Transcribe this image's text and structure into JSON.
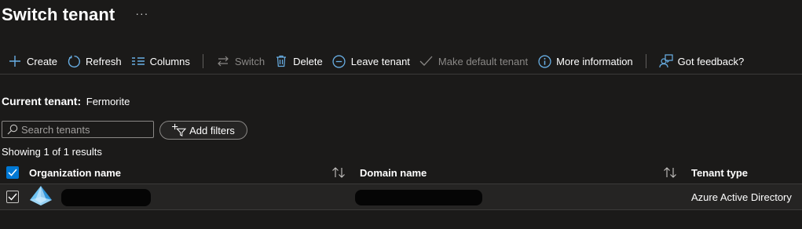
{
  "header": {
    "title": "Switch tenant",
    "more_label": "···"
  },
  "toolbar": {
    "create": "Create",
    "refresh": "Refresh",
    "columns": "Columns",
    "switch": "Switch",
    "delete": "Delete",
    "leave_tenant": "Leave tenant",
    "make_default": "Make default tenant",
    "more_info": "More information",
    "feedback": "Got feedback?"
  },
  "current_tenant": {
    "label": "Current tenant:",
    "value": "Fermorite"
  },
  "search": {
    "placeholder": "Search tenants",
    "value": ""
  },
  "filters": {
    "add_label": "Add filters"
  },
  "results": {
    "text": "Showing 1 of 1 results"
  },
  "table": {
    "columns": [
      "Organization name",
      "Domain name",
      "Tenant type"
    ],
    "rows": [
      {
        "org_name": "",
        "domain": "",
        "tenant_type": "Azure Active Directory",
        "selected": true
      }
    ]
  },
  "colors": {
    "background": "#1b1a19",
    "accent": "#0078d4",
    "icon_blue": "#69afe5",
    "disabled": "#8a8886",
    "row_background": "#252423"
  },
  "icons": {
    "create": "plus-icon",
    "refresh": "refresh-icon",
    "columns": "columns-icon",
    "switch": "switch-arrows-icon",
    "delete": "trash-icon",
    "leave": "minus-circle-icon",
    "make_default": "checkmark-icon",
    "more_info": "info-icon",
    "feedback": "feedback-person-icon",
    "search": "search-icon",
    "add_filter": "filter-add-icon",
    "sort": "sort-arrows-icon",
    "tenant_logo": "azure-ad-pyramid-icon"
  }
}
